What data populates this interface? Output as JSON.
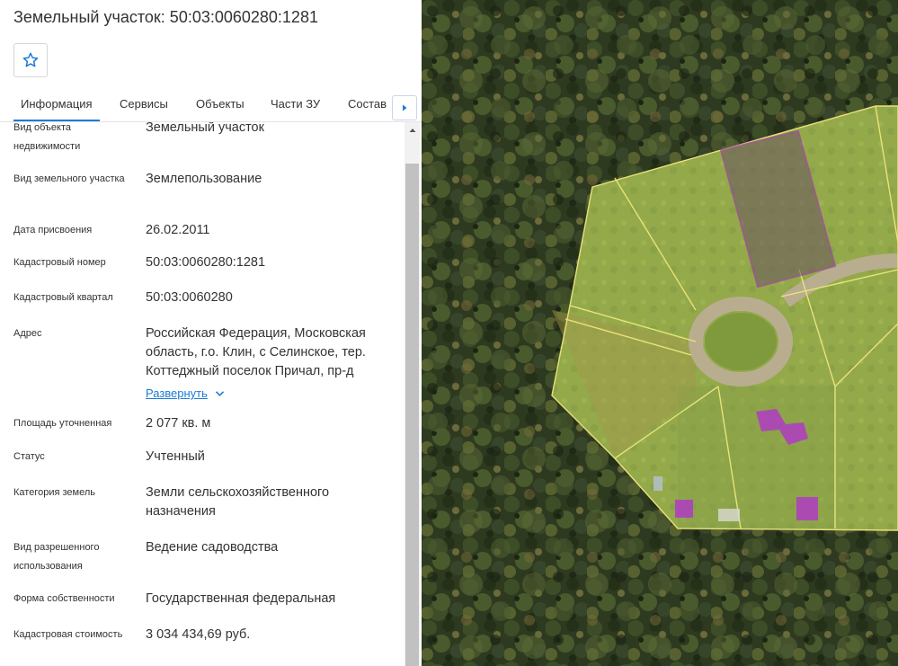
{
  "header": {
    "title": "Земельный участок: 50:03:0060280:1281"
  },
  "tabs": [
    {
      "label": "Информация",
      "active": true
    },
    {
      "label": "Сервисы",
      "active": false
    },
    {
      "label": "Объекты",
      "active": false
    },
    {
      "label": "Части ЗУ",
      "active": false
    },
    {
      "label": "Состав",
      "active": false
    }
  ],
  "info": {
    "rows": [
      {
        "label": "Вид объекта недвижимости",
        "value": "Земельный участок"
      },
      {
        "label": "Вид земельного участка",
        "value": "Землепользование"
      },
      {
        "label": "Дата присвоения",
        "value": "26.02.2011"
      },
      {
        "label": "Кадастровый номер",
        "value": "50:03:0060280:1281"
      },
      {
        "label": "Кадастровый квартал",
        "value": "50:03:0060280"
      },
      {
        "label": "Адрес",
        "value": "Российская Федерация, Московская область, г.о. Клин, с Селинское, тер. Коттеджный поселок Причал, пр-д"
      },
      {
        "label": "Площадь уточненная",
        "value": "2 077 кв. м"
      },
      {
        "label": "Статус",
        "value": "Учтенный"
      },
      {
        "label": "Категория земель",
        "value": "Земли сельскохозяйственного назначения"
      },
      {
        "label": "Вид разрешенного использования",
        "value": "Ведение садоводства"
      },
      {
        "label": "Форма собственности",
        "value": "Государственная федеральная"
      },
      {
        "label": "Кадастровая стоимость",
        "value": "3 034 434,69 руб."
      }
    ],
    "expand_label": "Развернуть"
  },
  "colors": {
    "accent": "#1f7ad6",
    "parcel_outline": "#e8e27a",
    "selected_parcel": "#9b2fae",
    "building": "#b03cc4"
  },
  "icons": {
    "favorite": "star-outline-icon",
    "tabs_next": "caret-right-icon",
    "expand": "chevron-down-icon",
    "scroll_up": "caret-up-icon"
  }
}
